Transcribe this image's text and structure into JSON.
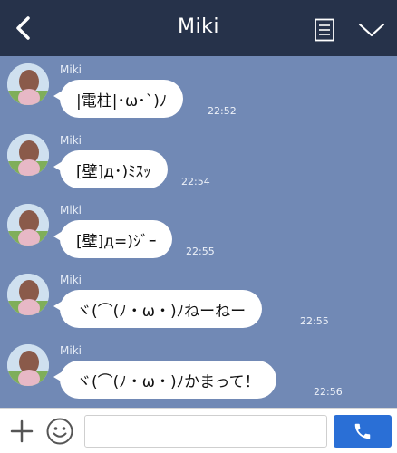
{
  "header": {
    "title": "Miki",
    "back_icon": "chevron-left-icon",
    "notes_icon": "notes-icon",
    "menu_icon": "chevron-down-icon"
  },
  "messages": [
    {
      "sender": "Miki",
      "text": "|電柱|･ω･`)ﾉ",
      "time": "22:52"
    },
    {
      "sender": "Miki",
      "text": "[壁]д･)ﾐｽｯ",
      "time": "22:54"
    },
    {
      "sender": "Miki",
      "text": "[壁]д=)ｼﾞｰ",
      "time": "22:55"
    },
    {
      "sender": "Miki",
      "text": "ヾ(⌒(ﾉ・ω・)ﾉねーねー",
      "time": "22:55"
    },
    {
      "sender": "Miki",
      "text": "ヾ(⌒(ﾉ・ω・)ﾉかまって！",
      "time": "22:56"
    }
  ],
  "input": {
    "value": "",
    "placeholder": ""
  },
  "colors": {
    "header_bg": "#26324a",
    "chat_bg": "#7189b5",
    "bubble_bg": "#ffffff",
    "send_button": "#2a6fd6"
  }
}
